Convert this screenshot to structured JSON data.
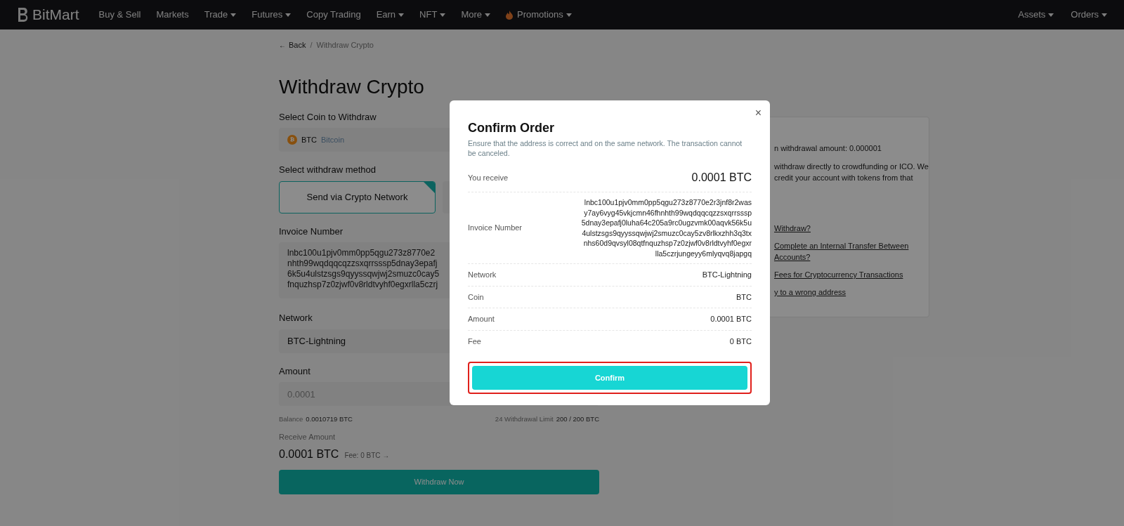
{
  "nav": {
    "brand": "BitMart",
    "items": [
      {
        "label": "Buy & Sell",
        "kind": "link",
        "dropdown": false
      },
      {
        "label": "Markets",
        "kind": "link",
        "dropdown": false
      },
      {
        "label": "Trade",
        "kind": "link",
        "dropdown": true
      },
      {
        "label": "Futures",
        "kind": "link",
        "dropdown": true
      },
      {
        "label": "Copy Trading",
        "kind": "link",
        "dropdown": false
      },
      {
        "label": "Earn",
        "kind": "link",
        "dropdown": true
      },
      {
        "label": "NFT",
        "kind": "link",
        "dropdown": true
      },
      {
        "label": "More",
        "kind": "link",
        "dropdown": true
      },
      {
        "label": "Promotions",
        "kind": "promo",
        "dropdown": true
      }
    ],
    "right_items": [
      {
        "label": "Assets",
        "dropdown": true
      },
      {
        "label": "Orders",
        "dropdown": true
      }
    ]
  },
  "breadcrumb": {
    "arrow": "←",
    "back": "Back",
    "separator": "/",
    "current": "Withdraw Crypto"
  },
  "form": {
    "title": "Withdraw Crypto",
    "coin_label": "Select Coin to Withdraw",
    "coin": {
      "glyph": "₿",
      "symbol": "BTC",
      "name": "Bitcoin"
    },
    "method_label": "Select withdraw method",
    "methods": [
      {
        "label": "Send via Crypto Network",
        "selected": true
      },
      {
        "selected": false
      }
    ],
    "invoice_label": "Invoice Number",
    "invoice_lines": [
      "lnbc100u1pjv0mm0pp5qgu273z8770e2",
      "nhth99wqdqqcqzzsxqrrsssp5dnay3epafj",
      "6k5u4ulstzsgs9qyyssqwjwj2smuzc0cay5",
      "fnquzhsp7z0zjwf0v8rldtvyhf0egxrlla5czrj"
    ],
    "network_label": "Network",
    "network_value": "BTC-Lightning",
    "amount_label": "Amount",
    "amount_placeholder": "0.0001",
    "balance_label": "Balance",
    "balance_value": "0.0010719 BTC",
    "limit_label": "24 Withdrawal Limit",
    "limit_value": "200 / 200 BTC",
    "receive_label": "Receive Amount",
    "receive_value": "0.0001 BTC",
    "fee_text": "Fee: 0 BTC",
    "fee_arrow": "→",
    "withdraw_button": "Withdraw Now"
  },
  "side_panel": {
    "texts": [
      "n withdrawal amount: 0.000001",
      "withdraw directly to crowdfunding or ICO. We credit your account with tokens from that"
    ],
    "links": [
      "Withdraw?",
      "Complete an Internal Transfer Between Accounts?",
      "Fees for Cryptocurrency Transactions",
      "y to a wrong address"
    ]
  },
  "modal": {
    "close": "×",
    "title": "Confirm Order",
    "subtitle": "Ensure that the address is correct and on the same network. The transaction cannot be canceled.",
    "rows": [
      {
        "kind": "large",
        "label": "You receive",
        "value": "0.0001 BTC"
      },
      {
        "kind": "multiline",
        "label": "Invoice Number",
        "lines": [
          "lnbc100u1pjv0mm0pp5qgu273z8770e2r3jnf8r2was",
          "y7ay6vyg45vkjcmn46fhnhth99wqdqqcqzzsxqrrsssp",
          "5dnay3epafj0luha64c205a9rc0ugzvmk00aqvk56k5u",
          "4ulstzsgs9qyyssqwjwj2smuzc0cay5zv8rlkxzhh3q3tx",
          "nhs60d9qvsyl08qtfnquzhsp7z0zjwf0v8rldtvyhf0egxr",
          "lla5czrjungeyy6mlyqvq8japgq"
        ]
      },
      {
        "kind": "plain",
        "label": "Network",
        "value": "BTC-Lightning"
      },
      {
        "kind": "plain",
        "label": "Coin",
        "value": "BTC"
      },
      {
        "kind": "plain",
        "label": "Amount",
        "value": "0.0001 BTC"
      },
      {
        "kind": "plain",
        "label": "Fee",
        "value": "0 BTC"
      }
    ],
    "confirm_button": "Confirm",
    "highlighted": true
  }
}
